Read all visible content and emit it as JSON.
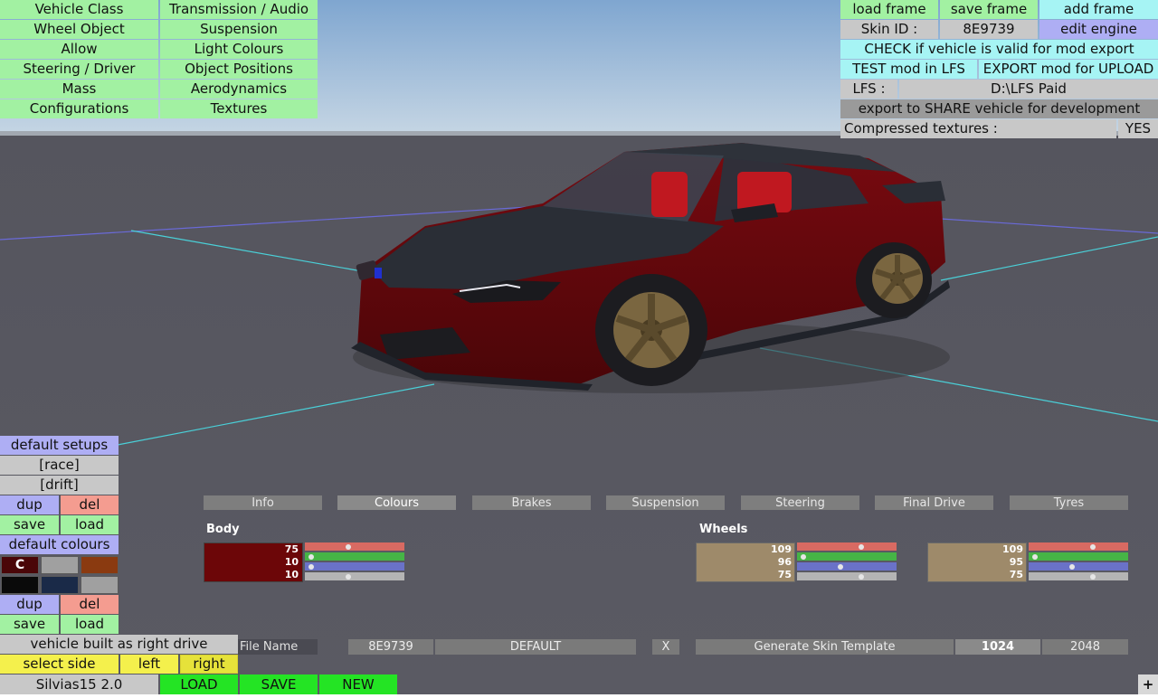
{
  "left_menu": [
    [
      "Vehicle Class",
      "Transmission / Audio"
    ],
    [
      "Wheel Object",
      "Suspension"
    ],
    [
      "Allow",
      "Light Colours"
    ],
    [
      "Steering / Driver",
      "Object Positions"
    ],
    [
      "Mass",
      "Aerodynamics"
    ],
    [
      "Configurations",
      "Textures"
    ]
  ],
  "top_right": {
    "load_frame": "load frame",
    "save_frame": "save frame",
    "add_frame": "add frame",
    "skin_id_label": "Skin ID :",
    "skin_id_value": "8E9739",
    "edit_engine": "edit engine",
    "check_valid": "CHECK if vehicle is valid for mod export",
    "test_mod": "TEST mod in LFS",
    "export_upload": "EXPORT mod for UPLOAD",
    "lfs_label": "LFS :",
    "lfs_path": "D:\\LFS Paid",
    "export_share": "export to SHARE vehicle for development",
    "compressed_label": "Compressed textures :",
    "compressed_value": "YES"
  },
  "left_panel": {
    "default_setups": "default setups",
    "race": "[race]",
    "drift": "[drift]",
    "dup": "dup",
    "del": "del",
    "save": "save",
    "load": "load",
    "default_colours": "default colours",
    "swatch_c": "C",
    "drive_side": "vehicle built as right drive",
    "select_side": "select side",
    "left": "left",
    "right": "right"
  },
  "colours": {
    "swatch_row1": [
      "#4a0608",
      "#a0a0a0",
      "#8a3a10"
    ],
    "swatch_row2": [
      "#0a0a0a",
      "#1a2a48",
      "#a0a0a0"
    ]
  },
  "tabs": [
    "Info",
    "Colours",
    "Brakes",
    "Suspension",
    "Steering",
    "Final Drive",
    "Tyres"
  ],
  "body": {
    "label": "Body",
    "color": "#6c0608",
    "values": [
      "75",
      "10",
      "10"
    ],
    "sliders": [
      0.43,
      0.04,
      0.04,
      0.43
    ]
  },
  "wheels": {
    "label": "Wheels",
    "color": "#9e8a6a",
    "values": [
      "109",
      "96",
      "75"
    ],
    "sliders": [
      0.65,
      0.04,
      0.43,
      0.65
    ]
  },
  "wheels2": {
    "color": "#9e8a6a",
    "values": [
      "109",
      "95",
      "75"
    ],
    "sliders": [
      0.65,
      0.04,
      0.43,
      0.65
    ]
  },
  "bottom": {
    "file_name": "File Name",
    "skin_id": "8E9739",
    "default": "DEFAULT",
    "x": "X",
    "generate": "Generate Skin Template",
    "res1": "1024",
    "res2": "2048",
    "vehicle_name": "Silvias15 2.0",
    "load": "LOAD",
    "save": "SAVE",
    "new": "NEW",
    "plus": "+"
  }
}
